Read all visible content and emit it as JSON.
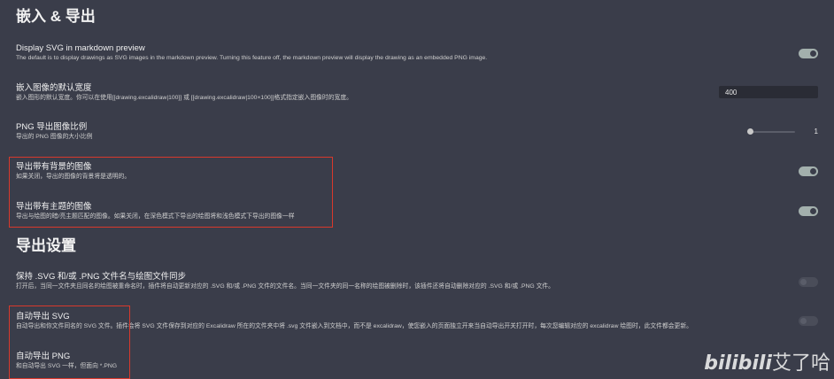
{
  "sections": {
    "embed_title": "嵌入 & 导出",
    "export_title": "导出设置"
  },
  "settings": {
    "display_svg": {
      "name": "Display SVG in markdown preview",
      "desc": "The default is to display drawings as SVG images in the markdown preview. Turning this feature off, the markdown preview will display the drawing as an embedded PNG image.",
      "enabled": true
    },
    "default_width": {
      "name": "嵌入图像的默认宽度",
      "desc": "嵌入图形的默认宽度。你可以在使用[[drawing.excalidraw|100]] 或 [[drawing.excalidraw|100×100]]格式指定嵌入图像时的宽度。",
      "value": "400"
    },
    "png_scale": {
      "name": "PNG 导出图像比例",
      "desc": "导出的 PNG 图像的大小比例",
      "value": "1"
    },
    "export_background": {
      "name": "导出带有背景的图像",
      "desc": "如果关闭，导出的图像的背景将是透明的。",
      "enabled": true
    },
    "export_theme": {
      "name": "导出带有主题的图像",
      "desc": "导出与绘图的暗/亮主题匹配的图像。如果关闭，在深色模式下导出的绘图将和浅色模式下导出的图像一样",
      "enabled": true
    },
    "keep_sync": {
      "name": "保持 .SVG 和/或 .PNG 文件名与绘图文件同步",
      "desc": "打开后，当同一文件夹且同名的绘图被重命名时，插件将自动更新对应的 .SVG 和/或 .PNG 文件的文件名。当同一文件夹的同一名称的绘图被删除时，该插件还将自动删除对应的 .SVG 和/或 .PNG 文件。",
      "enabled": false
    },
    "auto_svg": {
      "name": "自动导出 SVG",
      "desc": "自动导出和你文件同名的 SVG 文件。插件会将 SVG 文件保存到对应的 Excalidraw 所在的文件夹中将 .svg 文件嵌入到文档中，而不是 excalidraw，使您嵌入的页面独立开来当自动导出开关打开时，每次您编辑对应的 excalidraw 绘图时，此文件都会更新。",
      "enabled": false
    },
    "auto_png": {
      "name": "自动导出 PNG",
      "desc": "和自动导出 SVG 一样，但面向 *.PNG"
    }
  },
  "watermark": {
    "brand": "bilibili",
    "author": "艾了哈"
  },
  "colors": {
    "background": "#3a3d4a",
    "toggle_on": "#a3b0ad",
    "highlight": "#d8392c"
  }
}
